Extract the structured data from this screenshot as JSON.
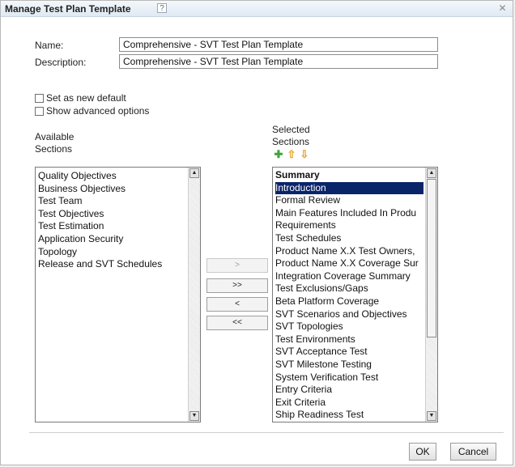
{
  "dialog": {
    "title": "Manage Test Plan Template",
    "help_glyph": "?",
    "close_glyph": "✕"
  },
  "form": {
    "name_label": "Name:",
    "name_value": "Comprehensive - SVT Test Plan Template",
    "description_label": "Description:",
    "description_value": "Comprehensive - SVT Test Plan Template",
    "set_default_label": "Set as new default",
    "set_default_checked": false,
    "advanced_label": "Show advanced options",
    "advanced_checked": false
  },
  "available": {
    "header_line1": "Available",
    "header_line2": "Sections",
    "items": [
      "Quality Objectives",
      "Business Objectives",
      "Test Team",
      "Test Objectives",
      "Test Estimation",
      "Application Security",
      "Topology",
      "Release and SVT Schedules"
    ]
  },
  "selected": {
    "header_line1": "Selected",
    "header_line2": "Sections",
    "toolbar_icons": [
      "add-icon",
      "move-up-icon",
      "move-down-icon"
    ],
    "selected_index": 1,
    "items": [
      "Summary",
      "Introduction",
      "Formal Review",
      "Main Features Included In Produ",
      "Requirements",
      "Test Schedules",
      "Product Name X.X Test Owners,",
      "Product Name X.X Coverage Sur",
      "Integration Coverage Summary",
      "Test Exclusions/Gaps",
      "Beta Platform Coverage",
      "SVT Scenarios and Objectives",
      "SVT Topologies",
      "Test Environments",
      "SVT Acceptance Test",
      "SVT Milestone Testing",
      "System Verification Test",
      "Entry Criteria",
      "Exit Criteria",
      "Ship Readiness Test"
    ]
  },
  "move_buttons": {
    "add": ">",
    "add_all": ">>",
    "remove": "<",
    "remove_all": "<<"
  },
  "footer": {
    "ok_label": "OK",
    "cancel_label": "Cancel"
  },
  "colors": {
    "selection": "#0a246a",
    "add_icon": "#3fa53a",
    "arrow_icon": "#e8a21c"
  }
}
